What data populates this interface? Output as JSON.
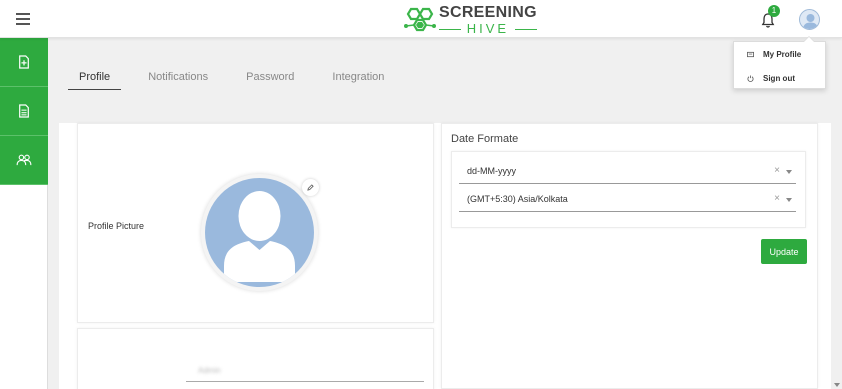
{
  "app": {
    "logo_line1": "SCREENING",
    "logo_line2": "HIVE",
    "brand_color": "#2eaa3f",
    "notification_count": "1"
  },
  "header_icons": [
    "hamburger-menu-icon",
    "bell-icon",
    "user-avatar-icon"
  ],
  "user_menu": {
    "items": [
      {
        "label": "My Profile",
        "icon": "profile-card-icon"
      },
      {
        "label": "Sign out",
        "icon": "power-icon"
      }
    ]
  },
  "sidebar": {
    "items": [
      {
        "icon": "add-document-icon"
      },
      {
        "icon": "document-icon"
      },
      {
        "icon": "users-icon"
      }
    ]
  },
  "tabs": [
    {
      "label": "Profile",
      "active": true
    },
    {
      "label": "Notifications",
      "active": false
    },
    {
      "label": "Password",
      "active": false
    },
    {
      "label": "Integration",
      "active": false
    }
  ],
  "profile": {
    "picture_label": "Profile Picture",
    "blurred_field_value": "Admin"
  },
  "settings": {
    "title": "Date Formate",
    "date_format": "dd-MM-yyyy",
    "timezone": "(GMT+5:30) Asia/Kolkata",
    "clear_symbol": "×",
    "update_label": "Update"
  }
}
